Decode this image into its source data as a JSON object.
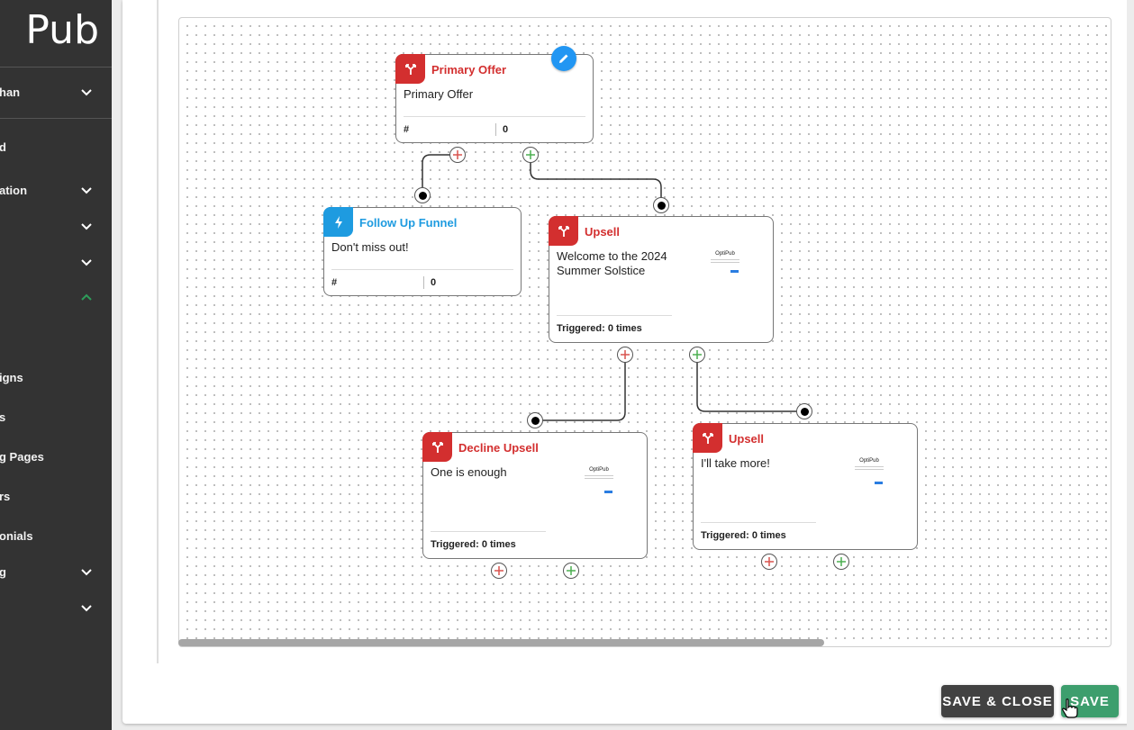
{
  "sidebar": {
    "logo": "Pub",
    "items": [
      {
        "label": "han",
        "chevron": "down"
      },
      {
        "label": "d",
        "chevron": null
      },
      {
        "label": "ation",
        "chevron": "down"
      },
      {
        "label": "",
        "chevron": "down"
      },
      {
        "label": "",
        "chevron": "down"
      },
      {
        "label": "",
        "chevron": "up"
      },
      {
        "label": "igns",
        "chevron": null
      },
      {
        "label": "s",
        "chevron": null
      },
      {
        "label": "g Pages",
        "chevron": null
      },
      {
        "label": "rs",
        "chevron": null
      },
      {
        "label": "onials",
        "chevron": null
      },
      {
        "label": "g",
        "chevron": "down"
      },
      {
        "label": "",
        "chevron": "down"
      }
    ]
  },
  "colors": {
    "sidebar_bg": "#333333",
    "offer_red": "#d32f2f",
    "funnel_blue": "#1e9be0",
    "edit_blue": "#2196f3",
    "save_green": "#3d9e6d",
    "save_close_dark": "#424242",
    "chevron_up_green": "#2e9d5a",
    "add_red": "#d9534f",
    "add_green": "#4caf50"
  },
  "flow": {
    "nodes": [
      {
        "id": "primary",
        "type": "offer",
        "icon": "split-icon",
        "title": "Primary Offer",
        "subtitle": "Primary Offer",
        "stat_label": "#",
        "stat_value": "0"
      },
      {
        "id": "followup",
        "type": "funnel",
        "icon": "bolt-icon",
        "title": "Follow Up Funnel",
        "subtitle": "Don't miss out!",
        "stat_label": "#",
        "stat_value": "0"
      },
      {
        "id": "upsell1",
        "type": "offer",
        "icon": "split-icon",
        "title": "Upsell",
        "subtitle": "Welcome to the 2024 Summer Solstice",
        "triggered": "Triggered: 0 times",
        "thumb_brand": "OptiPub"
      },
      {
        "id": "decline",
        "type": "offer",
        "icon": "split-icon",
        "title": "Decline Upsell",
        "subtitle": "One is enough",
        "triggered": "Triggered: 0 times",
        "thumb_brand": "OptiPub"
      },
      {
        "id": "upsell2",
        "type": "offer",
        "icon": "split-icon",
        "title": "Upsell",
        "subtitle": "I'll take more!",
        "triggered": "Triggered: 0 times",
        "thumb_brand": "OptiPub"
      }
    ]
  },
  "footer": {
    "save_close_label": "SAVE & CLOSE",
    "save_label": "SAVE"
  }
}
